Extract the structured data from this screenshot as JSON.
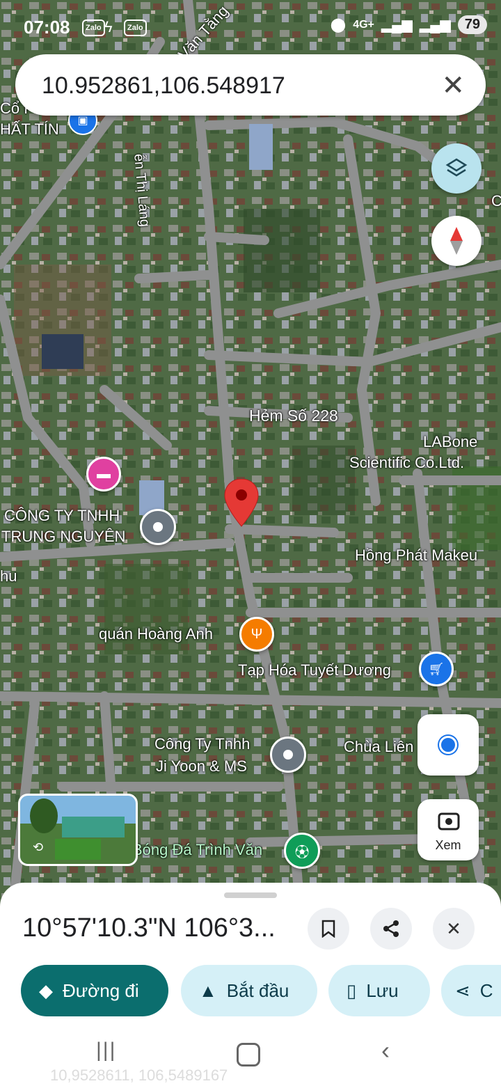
{
  "status_bar": {
    "time": "07:08",
    "badges": [
      "Zalo",
      "Zalo"
    ],
    "network": "4G+",
    "battery": "79"
  },
  "search": {
    "query": "10.952861,106.548917"
  },
  "map": {
    "streets": [
      "Văn Tằng",
      "ễn Thị Láng",
      "Hẻm Số 228"
    ],
    "places": [
      {
        "name": "Cổ P",
        "icon": "blue-pin-icon"
      },
      {
        "name": "HẤT TÍN",
        "icon": "none"
      },
      {
        "name": "LABone",
        "icon": "none"
      },
      {
        "name": "Scientific Co.Ltd.",
        "icon": "none"
      },
      {
        "name": "CÔNG TY TNHH",
        "icon": "none"
      },
      {
        "name": "TRUNG NGUYÊN",
        "icon": "gray-pin-icon"
      },
      {
        "name": "Hồng Phát Makeu",
        "icon": "none"
      },
      {
        "name": "quán Hoàng Anh",
        "icon": "restaurant-icon"
      },
      {
        "name": "Tạp Hóa Tuyết Dương",
        "icon": "shopping-cart-icon"
      },
      {
        "name": "Công Ty Tnhh",
        "icon": "none"
      },
      {
        "name": "Ji Yoon & MS",
        "icon": "gray-pin-icon"
      },
      {
        "name": "Chùa Liên",
        "icon": "none"
      },
      {
        "name": "Bóng Đá Trình Văn",
        "icon": "soccer-icon"
      },
      {
        "name": "hu",
        "icon": "none"
      },
      {
        "name": "C",
        "icon": "none"
      }
    ],
    "camera_label": "Xem"
  },
  "sheet": {
    "title": "10°57'10.3\"N 106°3...",
    "actions": {
      "directions": "Đường đi",
      "start": "Bắt đầu",
      "save": "Lưu",
      "share": "C"
    },
    "ghost_text": "10,9528611, 106,5489167"
  },
  "colors": {
    "accent_dark": "#0b6e6e",
    "pill_light": "#d5f0f7",
    "pin": "#e53935"
  }
}
